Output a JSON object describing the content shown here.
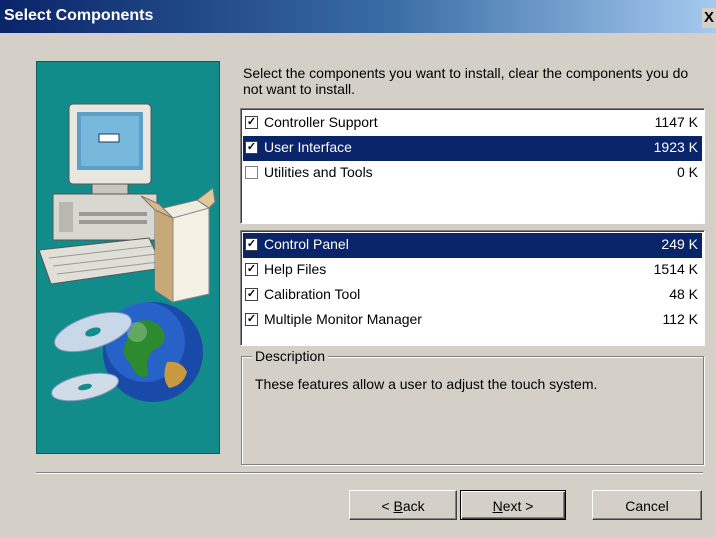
{
  "window": {
    "title": "Select Components",
    "close_glyph": "X"
  },
  "instructions": "Select the components you want to install, clear the components you do not want to install.",
  "components_top": [
    {
      "label": "Controller Support",
      "size": "1147 K",
      "checked": true,
      "selected": false
    },
    {
      "label": "User Interface",
      "size": "1923 K",
      "checked": true,
      "selected": true
    },
    {
      "label": "Utilities and Tools",
      "size": "0 K",
      "checked": false,
      "selected": false
    }
  ],
  "components_sub": [
    {
      "label": "Control Panel",
      "size": "249 K",
      "checked": true,
      "selected": true
    },
    {
      "label": "Help Files",
      "size": "1514 K",
      "checked": true,
      "selected": false
    },
    {
      "label": "Calibration Tool",
      "size": "48 K",
      "checked": true,
      "selected": false
    },
    {
      "label": "Multiple Monitor Manager",
      "size": "112 K",
      "checked": true,
      "selected": false
    }
  ],
  "description": {
    "legend": "Description",
    "text": "These features allow a user to adjust the touch system."
  },
  "buttons": {
    "back_pre": "< ",
    "back_key": "B",
    "back_post": "ack",
    "next_key": "N",
    "next_post": "ext >",
    "cancel": "Cancel"
  },
  "icons": {
    "computer": "computer-illustration",
    "globe": "globe-illustration",
    "cd": "cd-illustration",
    "box": "box-illustration"
  },
  "colors": {
    "titlebar_start": "#0a246a",
    "titlebar_end": "#a6caf0",
    "selection": "#0a246a",
    "banner": "#128b8b",
    "dialog": "#d4d0c8"
  }
}
